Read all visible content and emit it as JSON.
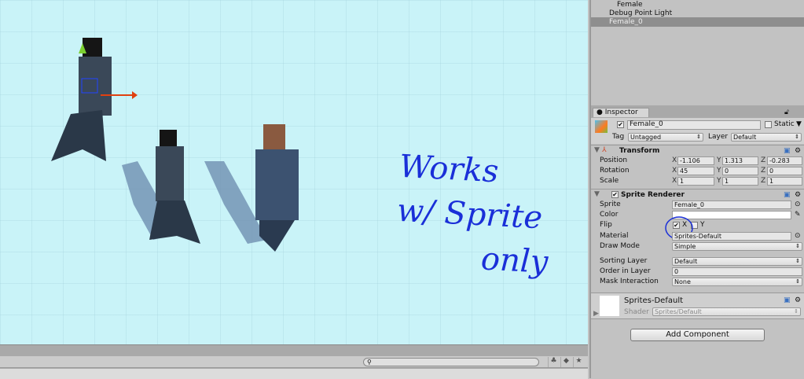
{
  "hierarchy": {
    "items": [
      "Female",
      "Debug Point Light",
      "Female_0"
    ]
  },
  "annotation": {
    "lines": [
      "Works",
      "w/ Sprite",
      "only"
    ],
    "color": "#1a2fd8"
  },
  "inspector": {
    "tab": "Inspector",
    "object_name": "Female_0",
    "static_label": "Static",
    "tag_label": "Tag",
    "tag_value": "Untagged",
    "layer_label": "Layer",
    "layer_value": "Default",
    "transform": {
      "title": "Transform",
      "rows": [
        {
          "label": "Position",
          "x": "-1.106",
          "y": "1.313",
          "z": "-0.283"
        },
        {
          "label": "Rotation",
          "x": "45",
          "y": "0",
          "z": "0"
        },
        {
          "label": "Scale",
          "x": "1",
          "y": "1",
          "z": "1"
        }
      ]
    },
    "sprite_renderer": {
      "title": "Sprite Renderer",
      "sprite_label": "Sprite",
      "sprite_value": "Female_0",
      "color_label": "Color",
      "flip_label": "Flip",
      "flip_x": "X",
      "flip_y": "Y",
      "material_label": "Material",
      "material_value": "Sprites-Default",
      "draw_mode_label": "Draw Mode",
      "draw_mode_value": "Simple",
      "sorting_layer_label": "Sorting Layer",
      "sorting_layer_value": "Default",
      "order_label": "Order in Layer",
      "order_value": "0",
      "mask_label": "Mask Interaction",
      "mask_value": "None"
    },
    "material": {
      "name": "Sprites-Default",
      "shader_label": "Shader",
      "shader_value": "Sprites/Default"
    },
    "add_component": "Add Component"
  },
  "axis_labels": {
    "x": "X",
    "y": "Y",
    "z": "Z"
  }
}
